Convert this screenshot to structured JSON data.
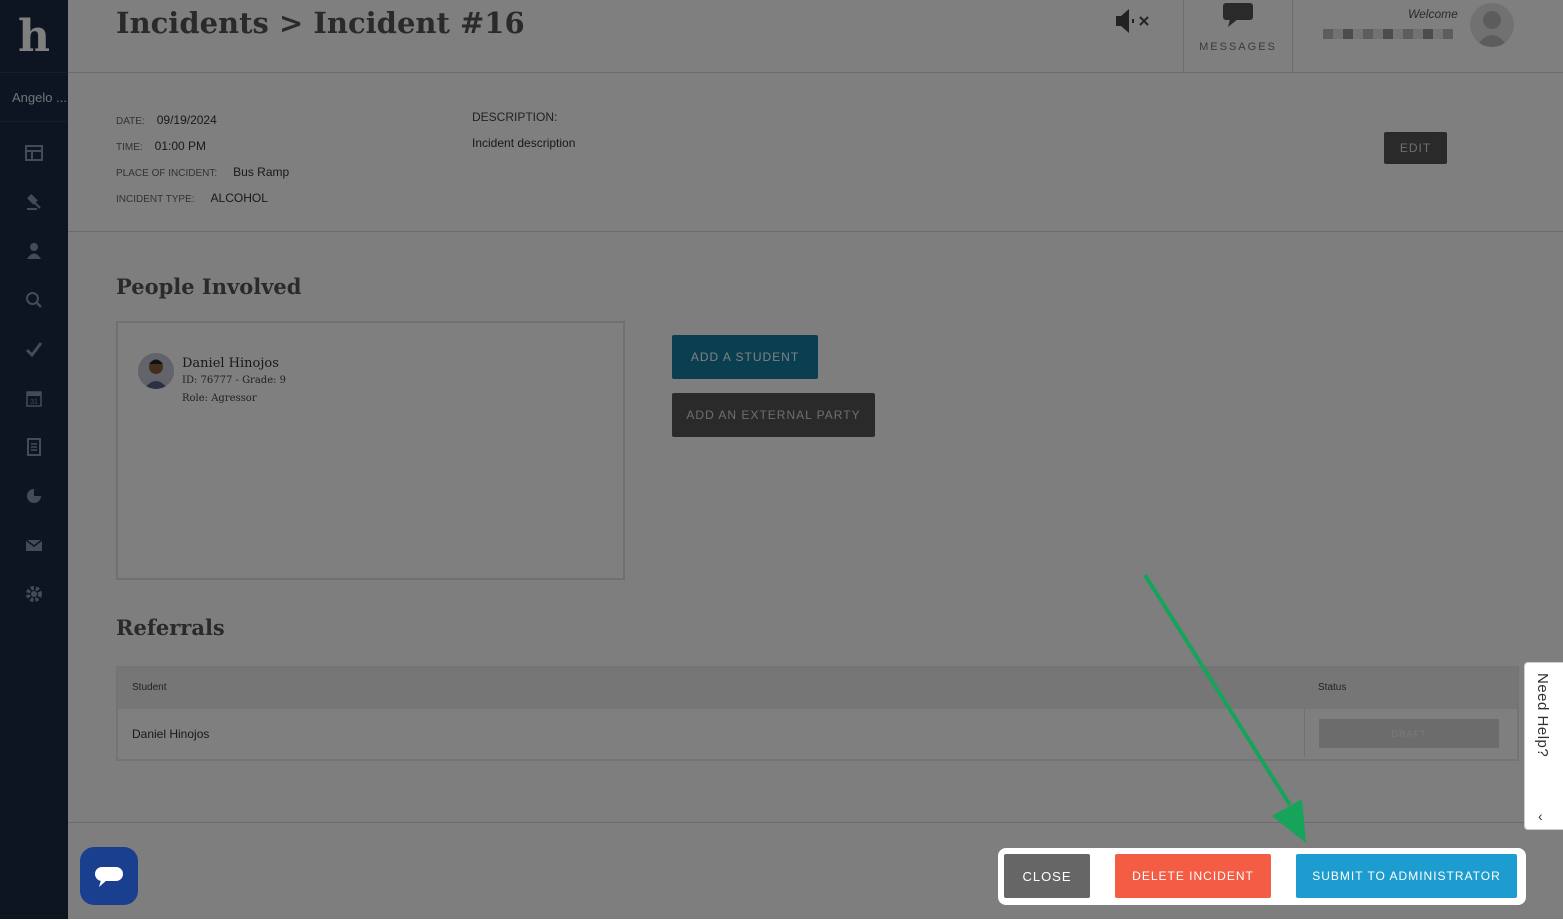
{
  "sidebar": {
    "logo": "h",
    "user_name": "Angelo ...",
    "items": [
      {
        "icon": "dashboard-icon"
      },
      {
        "icon": "gavel-icon"
      },
      {
        "icon": "students-icon"
      },
      {
        "icon": "search-icon"
      },
      {
        "icon": "checkmark-icon"
      },
      {
        "icon": "calendar-icon"
      },
      {
        "icon": "document-icon"
      },
      {
        "icon": "pie-chart-icon"
      },
      {
        "icon": "envelope-icon"
      },
      {
        "icon": "gear-icon"
      }
    ]
  },
  "header": {
    "title": "Incidents > Incident #16",
    "messages_label": "MESSAGES",
    "welcome": "Welcome"
  },
  "incident": {
    "date_label": "DATE:",
    "date": "09/19/2024",
    "time_label": "TIME:",
    "time": "01:00 PM",
    "place_label": "PLACE OF INCIDENT:",
    "place": "Bus Ramp",
    "type_label": "INCIDENT TYPE:",
    "type": "ALCOHOL",
    "description_label": "DESCRIPTION:",
    "description": "Incident description",
    "edit_label": "EDIT"
  },
  "people": {
    "heading": "People Involved",
    "person": {
      "name": "Daniel Hinojos",
      "id_grade": "ID: 76777 - Grade: 9",
      "role": "Role: Agressor"
    },
    "add_student_label": "ADD A STUDENT",
    "add_external_label": "ADD AN EXTERNAL PARTY"
  },
  "referrals": {
    "heading": "Referrals",
    "columns": [
      "Student",
      "Status"
    ],
    "rows": [
      {
        "student": "Daniel Hinojos",
        "status": "DRAFT"
      }
    ]
  },
  "help": {
    "label": "Need Help?"
  },
  "actions": {
    "close": "CLOSE",
    "delete": "DELETE INCIDENT",
    "submit": "SUBMIT TO ADMINISTRATOR"
  },
  "colors": {
    "sidebar": "#1a2a45",
    "primary": "#157fa5",
    "submit": "#1c9ccf",
    "delete": "#f45c43",
    "arrow": "#16a35a"
  }
}
